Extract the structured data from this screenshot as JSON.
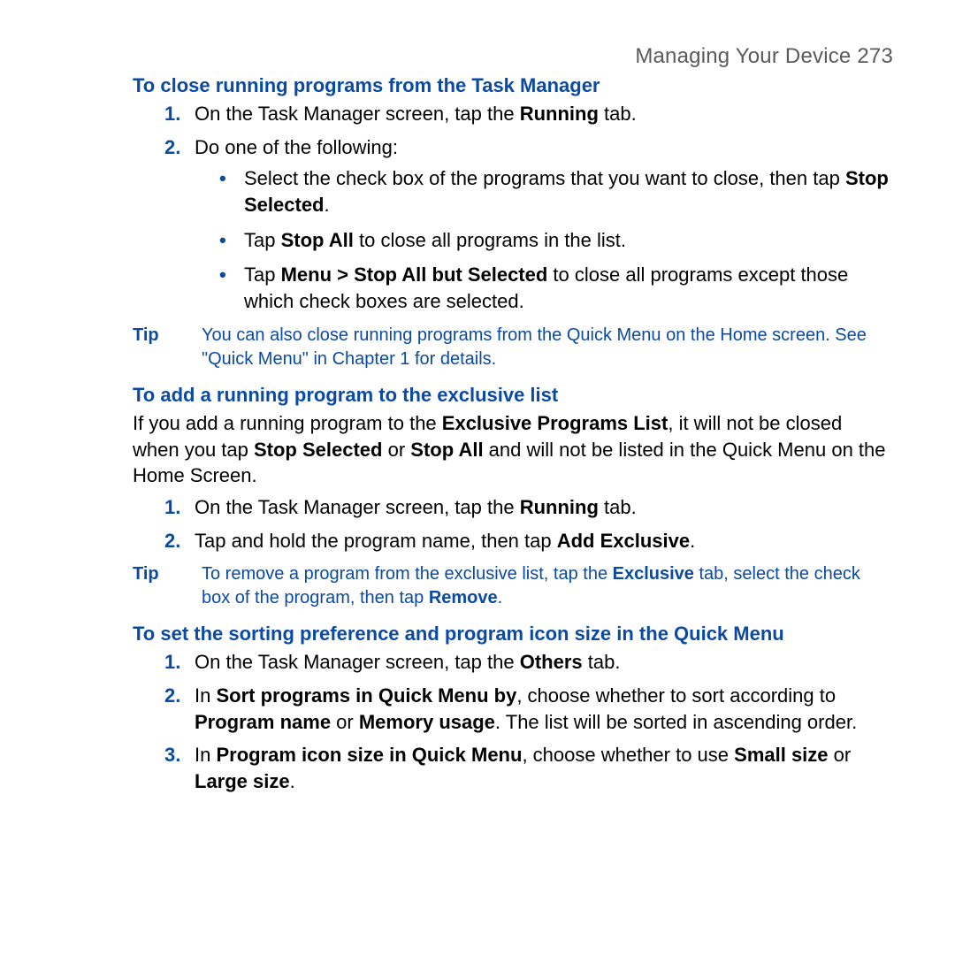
{
  "header": {
    "text": "Managing Your Device  273"
  },
  "section1": {
    "title": "To close running programs from the Task Manager",
    "step1": {
      "pre": "On the Task Manager screen, tap the ",
      "b1": "Running",
      "post": " tab."
    },
    "step2": {
      "text": "Do one of the following:"
    },
    "bullet1": {
      "pre": "Select the check box of the programs that you want to close, then tap ",
      "b1": "Stop Selected",
      "post": "."
    },
    "bullet2": {
      "pre": "Tap ",
      "b1": "Stop All",
      "post": " to close all programs in the list."
    },
    "bullet3": {
      "pre": "Tap ",
      "b1": "Menu > Stop All but Selected",
      "post": " to close all programs except those which check boxes are selected."
    }
  },
  "tip1": {
    "label": "Tip",
    "text": "You can also close running programs from the Quick Menu on the Home screen. See \"Quick Menu\" in Chapter 1 for details."
  },
  "section2": {
    "title": "To add a running program to the exclusive list",
    "intro": {
      "t1": "If you add a running program to the ",
      "b1": "Exclusive Programs List",
      "t2": ", it will not be closed when you tap ",
      "b2": "Stop Selected",
      "t3": " or ",
      "b3": "Stop All",
      "t4": " and will not be listed in the Quick Menu on the Home Screen."
    },
    "step1": {
      "pre": "On the Task Manager screen, tap the ",
      "b1": "Running",
      "post": " tab."
    },
    "step2": {
      "pre": "Tap and hold the program name, then tap ",
      "b1": "Add Exclusive",
      "post": "."
    }
  },
  "tip2": {
    "label": "Tip",
    "t1": "To remove a program from the exclusive list, tap the ",
    "b1": "Exclusive",
    "t2": " tab, select the check box of the program, then tap ",
    "b2": "Remove",
    "t3": "."
  },
  "section3": {
    "title": "To set the sorting preference and program icon size in the Quick Menu",
    "step1": {
      "pre": "On the Task Manager screen, tap the ",
      "b1": "Others",
      "post": " tab."
    },
    "step2": {
      "t1": "In ",
      "b1": "Sort programs in Quick Menu by",
      "t2": ", choose whether to sort according to ",
      "b2": "Program name",
      "t3": " or ",
      "b3": "Memory usage",
      "t4": ". The list will be sorted in ascending order."
    },
    "step3": {
      "t1": "In ",
      "b1": "Program icon size in Quick Menu",
      "t2": ", choose whether to use ",
      "b2": "Small size",
      "t3": " or ",
      "b3": "Large size",
      "t4": "."
    }
  }
}
